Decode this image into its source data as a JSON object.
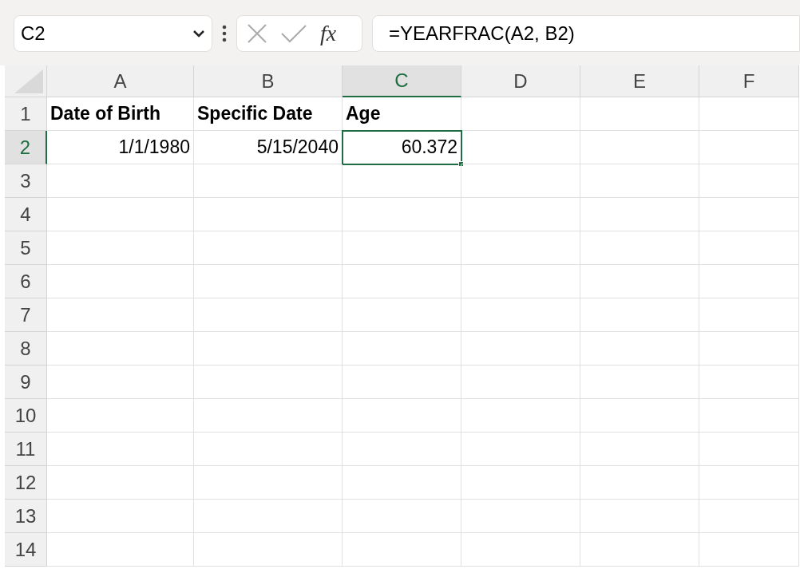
{
  "name_box": {
    "value": "C2"
  },
  "function_button": "fx",
  "formula_bar": {
    "value": "=YEARFRAC(A2, B2)"
  },
  "columns": [
    {
      "label": "A",
      "selected": false
    },
    {
      "label": "B",
      "selected": false
    },
    {
      "label": "C",
      "selected": true
    },
    {
      "label": "D",
      "selected": false
    },
    {
      "label": "E",
      "selected": false
    },
    {
      "label": "F",
      "selected": false
    }
  ],
  "rows": [
    {
      "label": "1",
      "selected": false,
      "cells": [
        {
          "text": "Date of Birth",
          "kind": "header",
          "selected": false
        },
        {
          "text": "Specific Date",
          "kind": "header",
          "selected": false
        },
        {
          "text": "Age",
          "kind": "header",
          "selected": false
        },
        {
          "selected": false
        },
        {
          "selected": false
        },
        {
          "selected": false
        }
      ]
    },
    {
      "label": "2",
      "selected": true,
      "cells": [
        {
          "text": "1/1/1980",
          "kind": "number",
          "selected": false
        },
        {
          "text": "5/15/2040",
          "kind": "number",
          "selected": false
        },
        {
          "text": "60.372",
          "kind": "number",
          "selected": true
        },
        {
          "selected": false
        },
        {
          "selected": false
        },
        {
          "selected": false
        }
      ]
    },
    {
      "label": "3",
      "selected": false,
      "cells": [
        {
          "selected": false
        },
        {
          "selected": false
        },
        {
          "selected": false
        },
        {
          "selected": false
        },
        {
          "selected": false
        },
        {
          "selected": false
        }
      ]
    },
    {
      "label": "4",
      "selected": false,
      "cells": [
        {
          "selected": false
        },
        {
          "selected": false
        },
        {
          "selected": false
        },
        {
          "selected": false
        },
        {
          "selected": false
        },
        {
          "selected": false
        }
      ]
    },
    {
      "label": "5",
      "selected": false,
      "cells": [
        {
          "selected": false
        },
        {
          "selected": false
        },
        {
          "selected": false
        },
        {
          "selected": false
        },
        {
          "selected": false
        },
        {
          "selected": false
        }
      ]
    },
    {
      "label": "6",
      "selected": false,
      "cells": [
        {
          "selected": false
        },
        {
          "selected": false
        },
        {
          "selected": false
        },
        {
          "selected": false
        },
        {
          "selected": false
        },
        {
          "selected": false
        }
      ]
    },
    {
      "label": "7",
      "selected": false,
      "cells": [
        {
          "selected": false
        },
        {
          "selected": false
        },
        {
          "selected": false
        },
        {
          "selected": false
        },
        {
          "selected": false
        },
        {
          "selected": false
        }
      ]
    },
    {
      "label": "8",
      "selected": false,
      "cells": [
        {
          "selected": false
        },
        {
          "selected": false
        },
        {
          "selected": false
        },
        {
          "selected": false
        },
        {
          "selected": false
        },
        {
          "selected": false
        }
      ]
    },
    {
      "label": "9",
      "selected": false,
      "cells": [
        {
          "selected": false
        },
        {
          "selected": false
        },
        {
          "selected": false
        },
        {
          "selected": false
        },
        {
          "selected": false
        },
        {
          "selected": false
        }
      ]
    },
    {
      "label": "10",
      "selected": false,
      "cells": [
        {
          "selected": false
        },
        {
          "selected": false
        },
        {
          "selected": false
        },
        {
          "selected": false
        },
        {
          "selected": false
        },
        {
          "selected": false
        }
      ]
    },
    {
      "label": "11",
      "selected": false,
      "cells": [
        {
          "selected": false
        },
        {
          "selected": false
        },
        {
          "selected": false
        },
        {
          "selected": false
        },
        {
          "selected": false
        },
        {
          "selected": false
        }
      ]
    },
    {
      "label": "12",
      "selected": false,
      "cells": [
        {
          "selected": false
        },
        {
          "selected": false
        },
        {
          "selected": false
        },
        {
          "selected": false
        },
        {
          "selected": false
        },
        {
          "selected": false
        }
      ]
    },
    {
      "label": "13",
      "selected": false,
      "cells": [
        {
          "selected": false
        },
        {
          "selected": false
        },
        {
          "selected": false
        },
        {
          "selected": false
        },
        {
          "selected": false
        },
        {
          "selected": false
        }
      ]
    },
    {
      "label": "14",
      "selected": false,
      "cells": [
        {
          "selected": false
        },
        {
          "selected": false
        },
        {
          "selected": false
        },
        {
          "selected": false
        },
        {
          "selected": false
        },
        {
          "selected": false
        }
      ]
    }
  ]
}
